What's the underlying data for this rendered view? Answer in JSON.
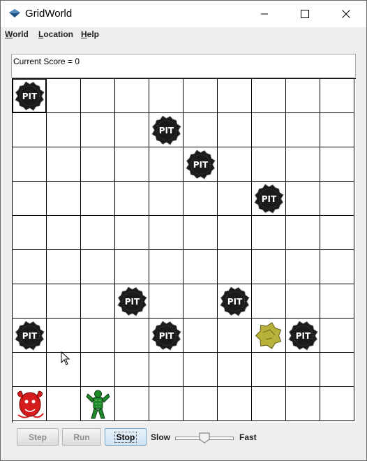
{
  "window": {
    "title": "GridWorld",
    "icon": "gridworld-diamond-icon"
  },
  "menu": {
    "items": [
      {
        "mnemonic": "W",
        "rest": "orld"
      },
      {
        "mnemonic": "L",
        "rest": "ocation"
      },
      {
        "mnemonic": "H",
        "rest": "elp"
      }
    ]
  },
  "status": {
    "score_text": "Current Score = 0"
  },
  "grid": {
    "rows": 10,
    "cols": 10,
    "selected_cell": {
      "row": 0,
      "col": 0
    },
    "pit_label": "PIT",
    "actors": [
      {
        "type": "pit",
        "row": 0,
        "col": 0
      },
      {
        "type": "pit",
        "row": 1,
        "col": 4
      },
      {
        "type": "pit",
        "row": 2,
        "col": 5
      },
      {
        "type": "pit",
        "row": 3,
        "col": 7
      },
      {
        "type": "pit",
        "row": 6,
        "col": 3
      },
      {
        "type": "pit",
        "row": 6,
        "col": 6
      },
      {
        "type": "pit",
        "row": 7,
        "col": 0
      },
      {
        "type": "pit",
        "row": 7,
        "col": 4
      },
      {
        "type": "gold",
        "row": 7,
        "col": 7
      },
      {
        "type": "pit",
        "row": 7,
        "col": 8
      },
      {
        "type": "wumpus",
        "row": 9,
        "col": 0
      },
      {
        "type": "hunter",
        "row": 9,
        "col": 2
      }
    ]
  },
  "controls": {
    "step_label": "Step",
    "run_label": "Run",
    "stop_label": "Stop",
    "slow_label": "Slow",
    "fast_label": "Fast",
    "speed_fraction": 0.5
  },
  "colors": {
    "pit": "#1a1a1a",
    "gold": "#b8b23a",
    "wumpus": "#d41c1c",
    "hunter": "#1f8a2a"
  }
}
